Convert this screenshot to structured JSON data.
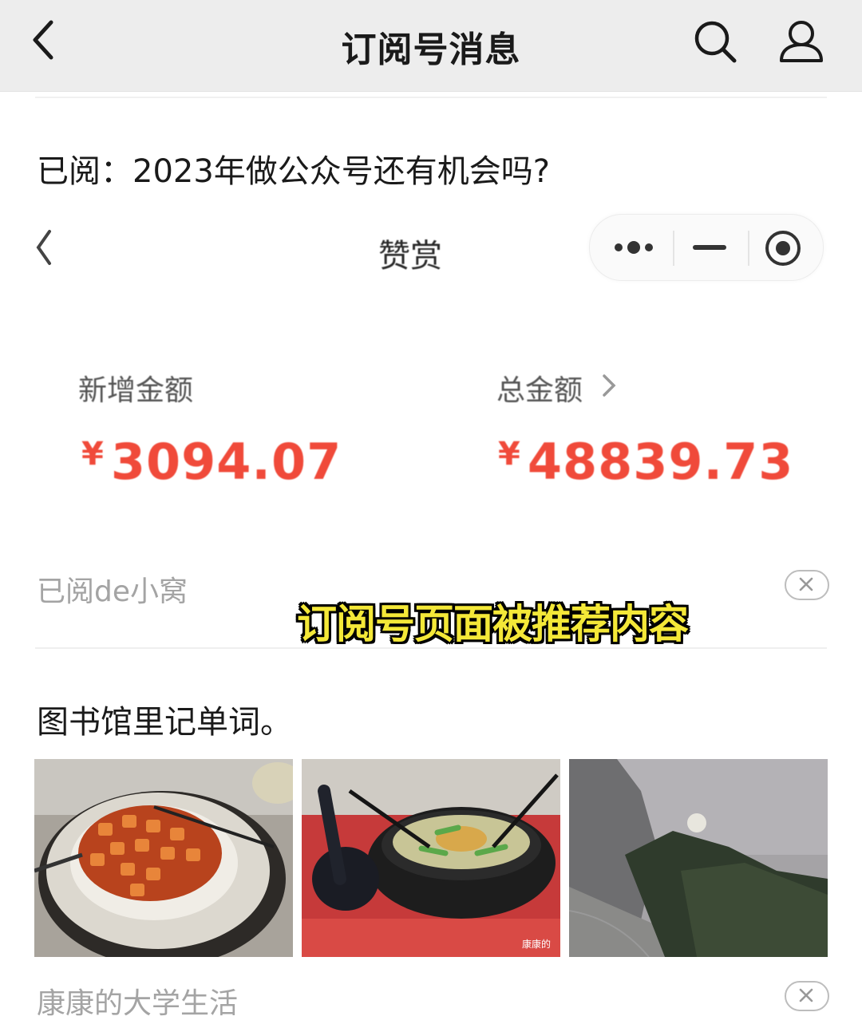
{
  "topbar": {
    "title": "订阅号消息",
    "back_icon": "chevron-left-icon",
    "search_icon": "search-icon",
    "profile_icon": "person-icon"
  },
  "feed": [
    {
      "title": "已阅：2023年做公众号还有机会吗?",
      "embed": {
        "page_title": "赞赏",
        "new_amount_label": "新增金额",
        "new_amount_currency": "¥",
        "new_amount_value": "3094.07",
        "total_amount_label": "总金额",
        "total_amount_currency": "¥",
        "total_amount_value": "48839.73"
      },
      "source": "已阅de小窝"
    },
    {
      "title": "图书馆里记单词。",
      "photos": [
        "mapo-tofu-rice-photo",
        "noodle-bowl-photo",
        "cloudy-sky-hill-photo"
      ],
      "watermark": "康康的",
      "source": "康康的大学生活"
    }
  ],
  "caption": "订阅号页面被推荐内容",
  "colors": {
    "topbar_bg": "#ededed",
    "amount_red": "#f04a3a",
    "caption_yellow": "#f4e838",
    "muted_text": "#a4a4a4"
  }
}
